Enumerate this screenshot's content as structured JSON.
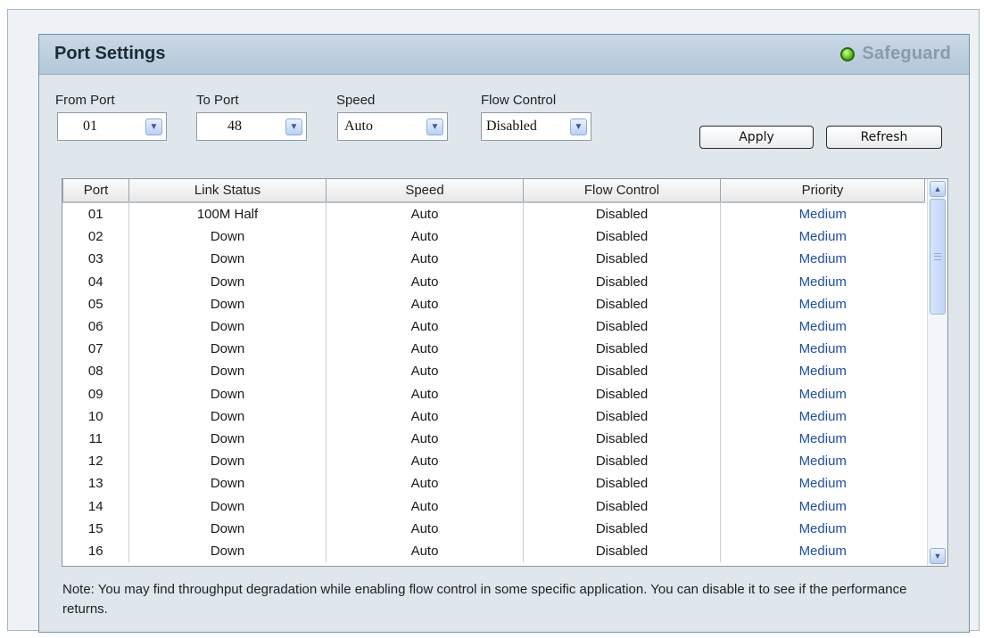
{
  "page": {
    "title": "Port Settings",
    "safeguard_label": "Safeguard"
  },
  "form": {
    "from_port": {
      "label": "From Port",
      "value": "01"
    },
    "to_port": {
      "label": "To Port",
      "value": "48"
    },
    "speed": {
      "label": "Speed",
      "value": "Auto"
    },
    "flow_control": {
      "label": "Flow Control",
      "value": "Disabled"
    }
  },
  "buttons": {
    "apply": "Apply",
    "refresh": "Refresh"
  },
  "table": {
    "headers": [
      "Port",
      "Link Status",
      "Speed",
      "Flow Control",
      "Priority"
    ],
    "rows": [
      [
        "01",
        "100M Half",
        "Auto",
        "Disabled",
        "Medium"
      ],
      [
        "02",
        "Down",
        "Auto",
        "Disabled",
        "Medium"
      ],
      [
        "03",
        "Down",
        "Auto",
        "Disabled",
        "Medium"
      ],
      [
        "04",
        "Down",
        "Auto",
        "Disabled",
        "Medium"
      ],
      [
        "05",
        "Down",
        "Auto",
        "Disabled",
        "Medium"
      ],
      [
        "06",
        "Down",
        "Auto",
        "Disabled",
        "Medium"
      ],
      [
        "07",
        "Down",
        "Auto",
        "Disabled",
        "Medium"
      ],
      [
        "08",
        "Down",
        "Auto",
        "Disabled",
        "Medium"
      ],
      [
        "09",
        "Down",
        "Auto",
        "Disabled",
        "Medium"
      ],
      [
        "10",
        "Down",
        "Auto",
        "Disabled",
        "Medium"
      ],
      [
        "11",
        "Down",
        "Auto",
        "Disabled",
        "Medium"
      ],
      [
        "12",
        "Down",
        "Auto",
        "Disabled",
        "Medium"
      ],
      [
        "13",
        "Down",
        "Auto",
        "Disabled",
        "Medium"
      ],
      [
        "14",
        "Down",
        "Auto",
        "Disabled",
        "Medium"
      ],
      [
        "15",
        "Down",
        "Auto",
        "Disabled",
        "Medium"
      ],
      [
        "16",
        "Down",
        "Auto",
        "Disabled",
        "Medium"
      ]
    ]
  },
  "note": "Note: You may find throughput degradation while enabling flow control in some specific application. You can disable it to see if the performance returns.",
  "icons": {
    "status": "green-led-icon",
    "dropdown": "chevron-down-icon",
    "scroll_up": "scroll-up-arrow-icon",
    "scroll_down": "scroll-down-arrow-icon"
  },
  "colors": {
    "title_bar": "#b9cbdb",
    "panel_bg": "#dfe6ec",
    "priority_text": "#1f4fa6",
    "led_green": "#6fcf2a"
  }
}
